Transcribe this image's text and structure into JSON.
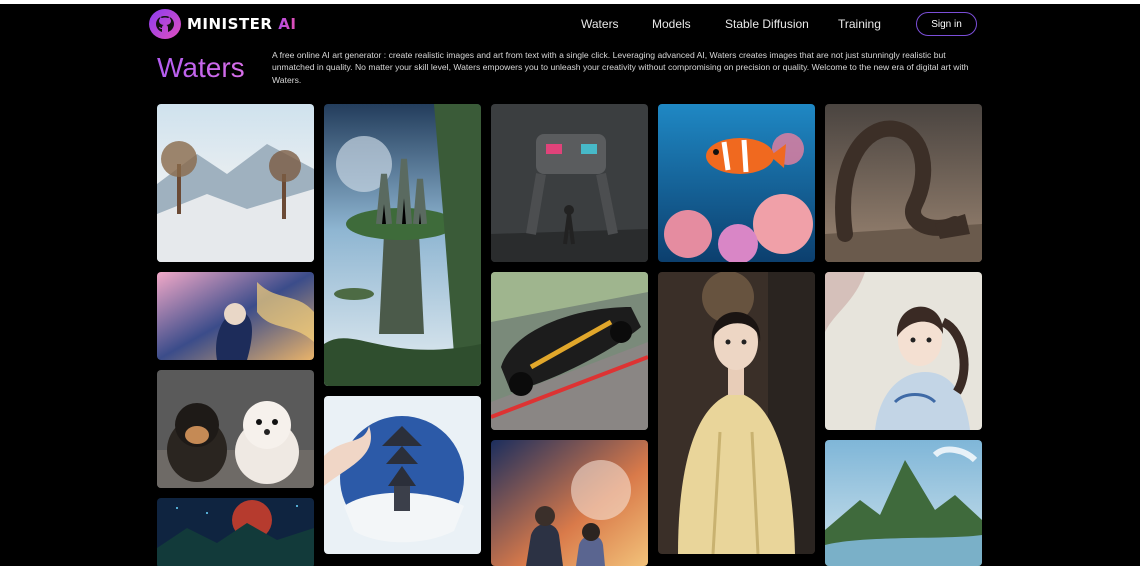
{
  "brand": {
    "name_main": "MINISTER",
    "name_accent": " AI"
  },
  "nav": {
    "items": [
      "Waters",
      "Models",
      "Stable Diffusion",
      "Training"
    ],
    "sign_in": "Sign in"
  },
  "hero": {
    "title": "Waters",
    "description": "A free online AI art generator : create realistic images and art from text with a single click. Leveraging advanced AI, Waters creates images that are not just stunningly realistic but unmatched in quality. No matter your skill level, Waters empowers you to unleash your creativity without compromising on precision or quality. Welcome to the new era of digital art with Waters."
  },
  "colors": {
    "accent": "#8b3cf0",
    "accent2": "#e04fbf",
    "background": "#000000"
  },
  "gallery": [
    "snowy-landscape",
    "floating-island",
    "mech-robot",
    "clownfish-reef",
    "desert-serpent",
    "anime-girl-flowers",
    "race-car",
    "woman-yellow-robe",
    "anime-girl-ponytail",
    "puppies",
    "pagoda-circle",
    "couple-sky",
    "mountain-lake",
    "night-landscape"
  ]
}
